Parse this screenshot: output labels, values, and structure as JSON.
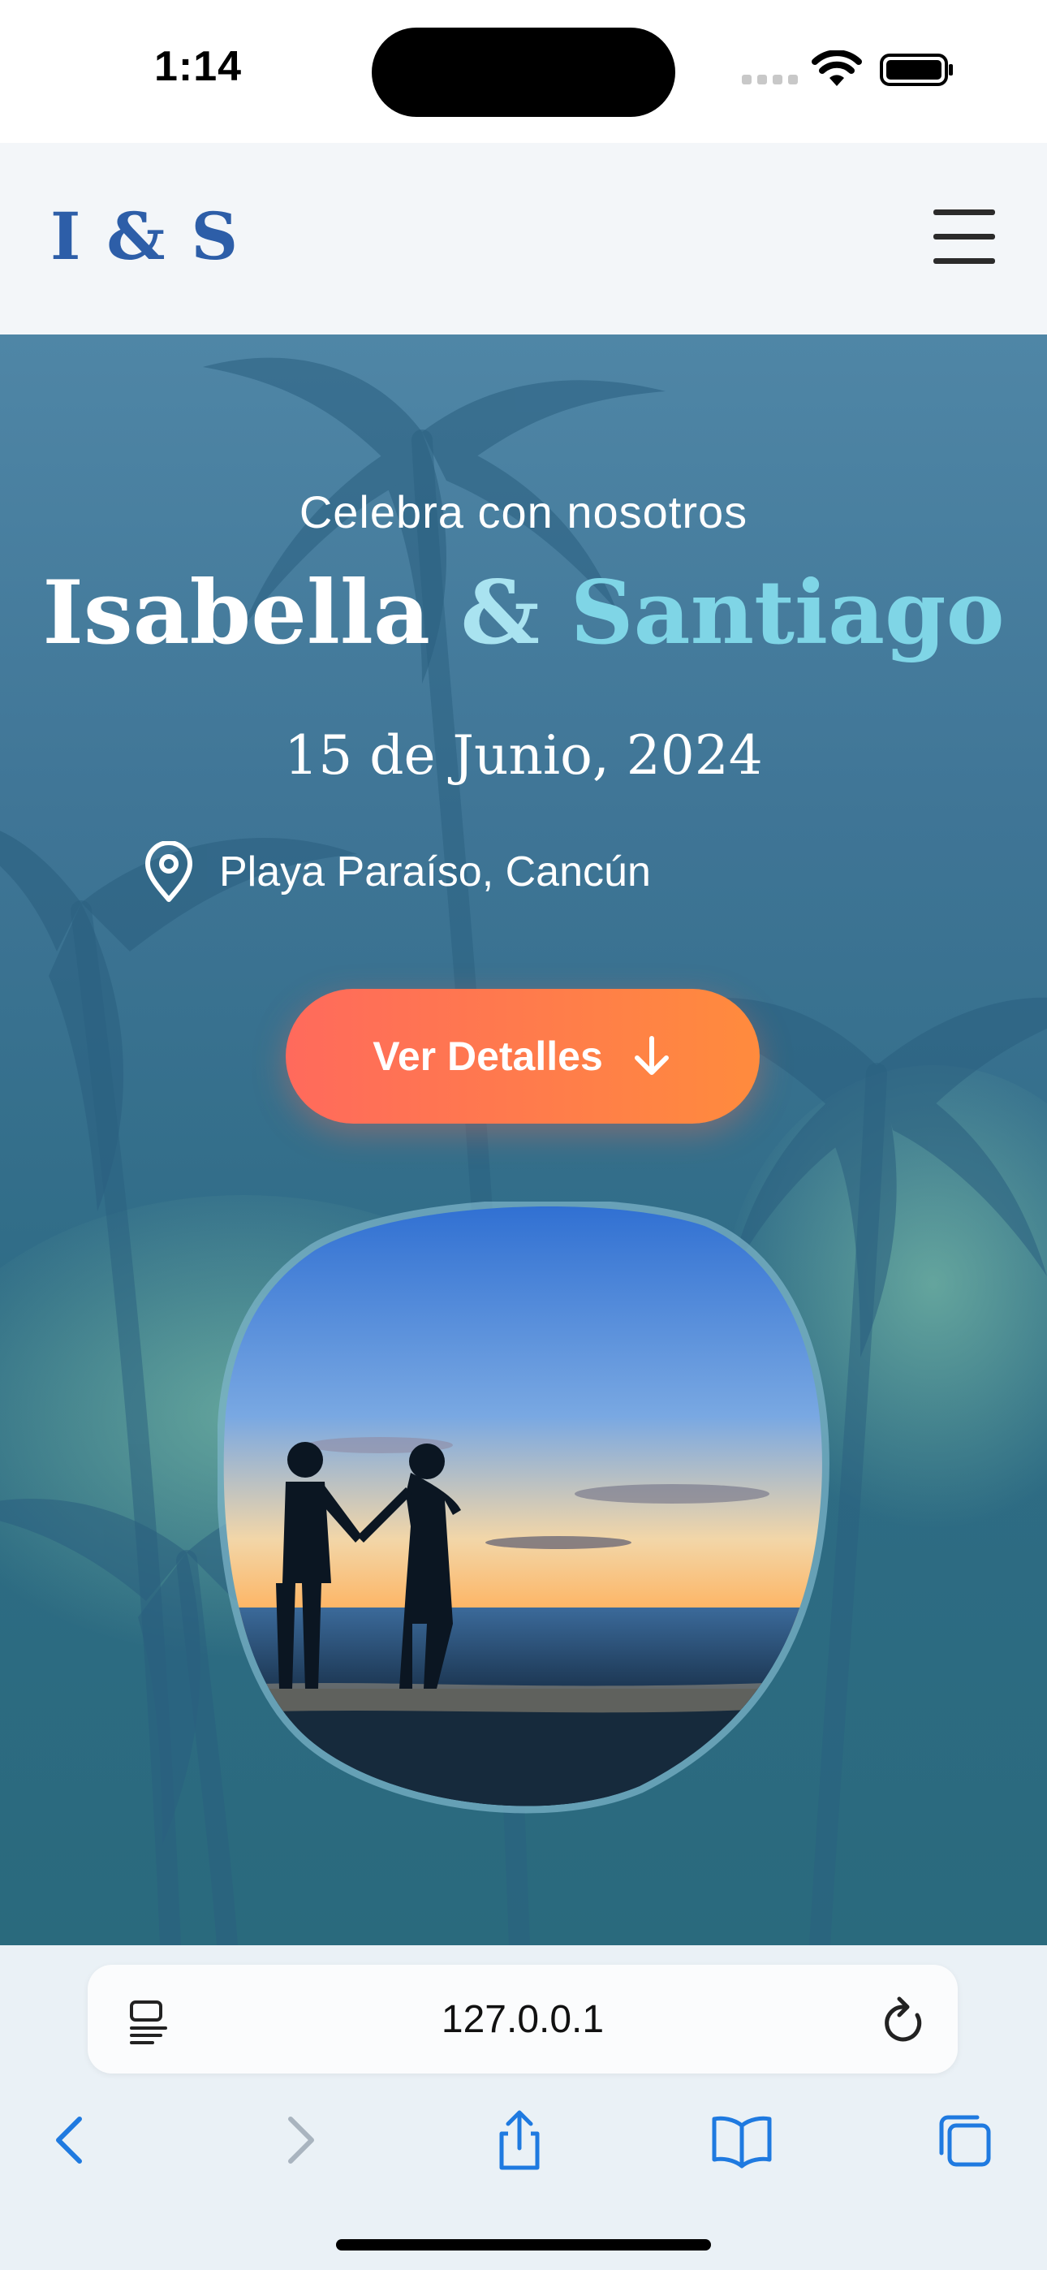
{
  "status_bar": {
    "time": "1:14"
  },
  "header": {
    "logo": "I & S",
    "menu_icon": "hamburger-menu-icon"
  },
  "hero": {
    "subtitle": "Celebra con nosotros",
    "bride": "Isabella",
    "amp": "&",
    "groom": "Santiago",
    "date": "15 de Junio, 2024",
    "location": "Playa Paraíso, Cancún",
    "location_icon": "map-pin-icon",
    "button_label": "Ver Detalles",
    "button_icon": "arrow-down-icon",
    "colors": {
      "button_start": "#ff6a5c",
      "button_end": "#ff8b3d",
      "accent_name": "#7fd5e6",
      "logo": "#2d5ea8"
    }
  },
  "browser": {
    "url": "127.0.0.1",
    "icons": [
      "reader-icon",
      "reload-icon",
      "back-icon",
      "forward-icon",
      "share-icon",
      "bookmarks-icon",
      "tabs-icon"
    ]
  }
}
